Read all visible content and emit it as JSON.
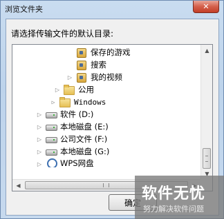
{
  "window": {
    "title": "浏览文件夹",
    "close_label": "✕"
  },
  "dialog": {
    "prompt": "请选择传输文件的默认目录:",
    "ok_label": "确定"
  },
  "tree": {
    "items": [
      {
        "label": "保存的游戏",
        "icon": "saved-games-folder-icon",
        "expander": ""
      },
      {
        "label": "搜索",
        "icon": "search-folder-icon",
        "expander": ""
      },
      {
        "label": "我的视频",
        "icon": "videos-folder-icon",
        "expander": "▷"
      },
      {
        "label": "公用",
        "icon": "folder-icon",
        "expander": "▷"
      },
      {
        "label": "Windows",
        "icon": "folder-icon",
        "expander": "▷"
      },
      {
        "label": "软件  (D:)",
        "icon": "drive-icon",
        "expander": "▷"
      },
      {
        "label": "本地磁盘  (E:)",
        "icon": "drive-icon",
        "expander": "▷"
      },
      {
        "label": "公司文件  (F:)",
        "icon": "drive-icon",
        "expander": "▷"
      },
      {
        "label": "本地磁盘  (G:)",
        "icon": "drive-icon",
        "expander": "▷"
      },
      {
        "label": "WPS网盘",
        "icon": "network-drive-icon",
        "expander": "▷"
      }
    ]
  },
  "watermark": {
    "main": "软件无忧",
    "sub": "努力解决软件问题"
  }
}
